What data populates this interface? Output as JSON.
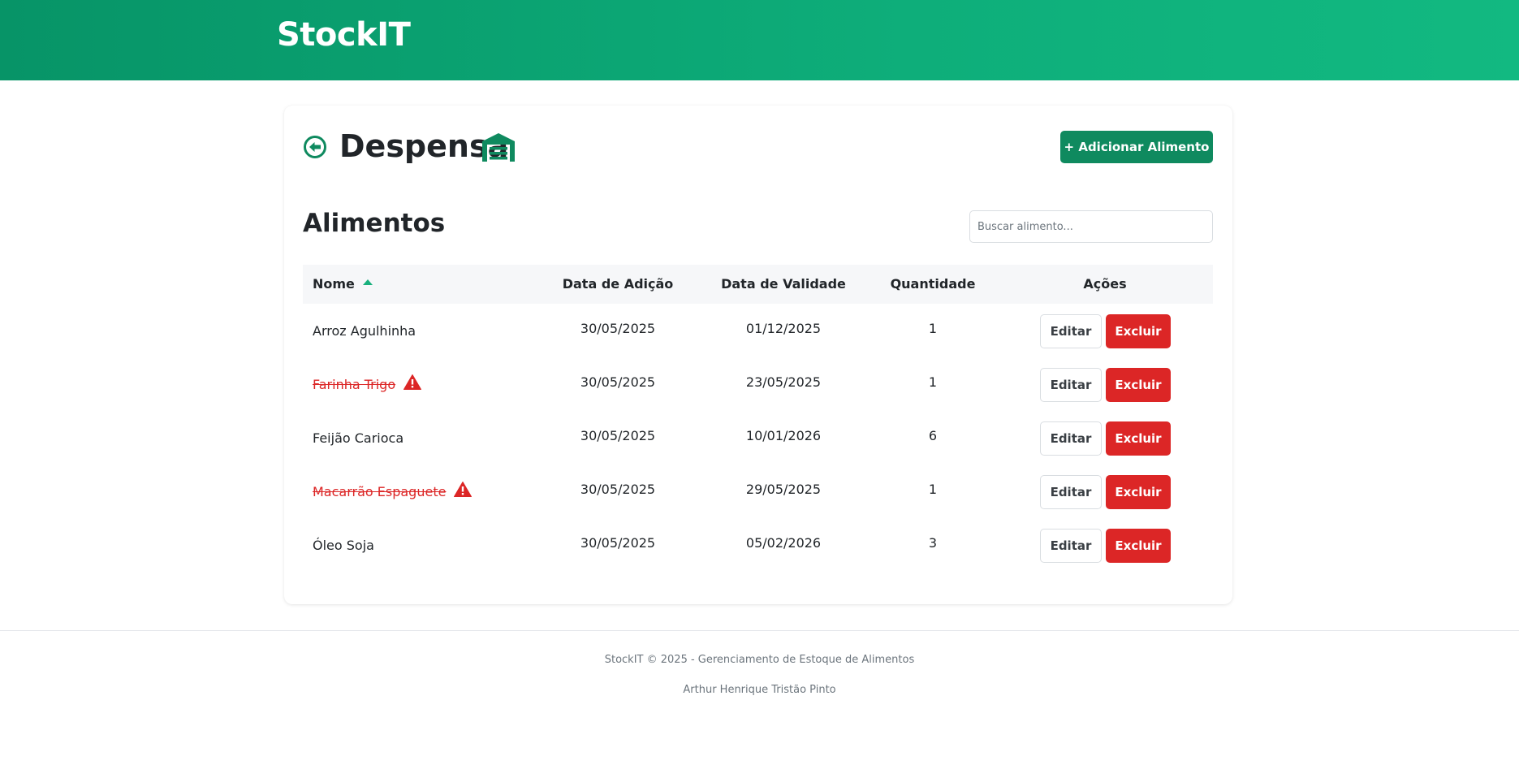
{
  "header": {
    "brand": "StockIT"
  },
  "page": {
    "title": "Despensa",
    "add_button_label": "+ Adicionar Alimento"
  },
  "foods": {
    "section_title": "Alimentos",
    "search": {
      "placeholder": "Buscar alimento...",
      "value": ""
    },
    "columns": {
      "name": "Nome",
      "added": "Data de Adição",
      "expiry": "Data de Validade",
      "quantity": "Quantidade",
      "actions": "Ações"
    },
    "sort": {
      "column": "Nome",
      "direction": "asc"
    },
    "rows": [
      {
        "name": "Arroz Agulhinha",
        "added": "30/05/2025",
        "expiry": "01/12/2025",
        "quantity": "1",
        "expired": false,
        "edit": "Editar",
        "delete": "Excluir"
      },
      {
        "name": "Farinha Trigo",
        "added": "30/05/2025",
        "expiry": "23/05/2025",
        "quantity": "1",
        "expired": true,
        "edit": "Editar",
        "delete": "Excluir"
      },
      {
        "name": "Feijão Carioca",
        "added": "30/05/2025",
        "expiry": "10/01/2026",
        "quantity": "6",
        "expired": false,
        "edit": "Editar",
        "delete": "Excluir"
      },
      {
        "name": "Macarrão Espaguete",
        "added": "30/05/2025",
        "expiry": "29/05/2025",
        "quantity": "1",
        "expired": true,
        "edit": "Editar",
        "delete": "Excluir"
      },
      {
        "name": "Óleo Soja",
        "added": "30/05/2025",
        "expiry": "05/02/2026",
        "quantity": "3",
        "expired": false,
        "edit": "Editar",
        "delete": "Excluir"
      }
    ]
  },
  "footer": {
    "copyright": "StockIT © 2025 - Gerenciamento de Estoque de Alimentos",
    "author": "Arthur Henrique Tristão Pinto"
  },
  "colors": {
    "brand_green": "#0f8a5f",
    "header_gradient_start": "#079467",
    "header_gradient_end": "#12b981",
    "danger_red": "#dc2626",
    "sort_indicator": "#18b07c"
  },
  "icons": {
    "back": "arrow-circle-left-icon",
    "title": "warehouse-icon",
    "sort": "caret-up-icon",
    "expired": "warning-triangle-icon"
  }
}
